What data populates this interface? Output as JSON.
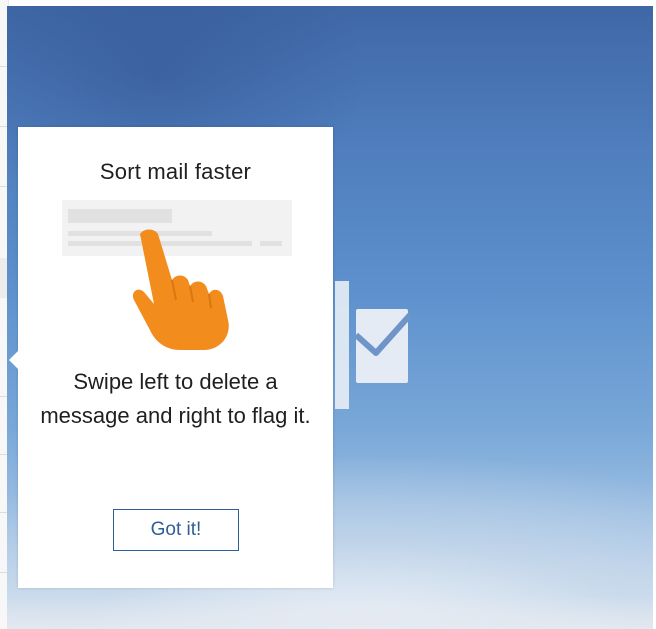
{
  "tip": {
    "title": "Sort mail faster",
    "body": "Swipe left to delete a message and right to flag it.",
    "button_label": "Got it!"
  },
  "icons": {
    "illustration": "swipe-hand-icon",
    "background_icon": "mail-envelope-icon"
  },
  "colors": {
    "hand": "#f28c1c",
    "button_border": "#2e5f94",
    "button_text": "#2e5f94",
    "background_top": "#3f67a6",
    "background_bottom": "#d9e4f0"
  }
}
